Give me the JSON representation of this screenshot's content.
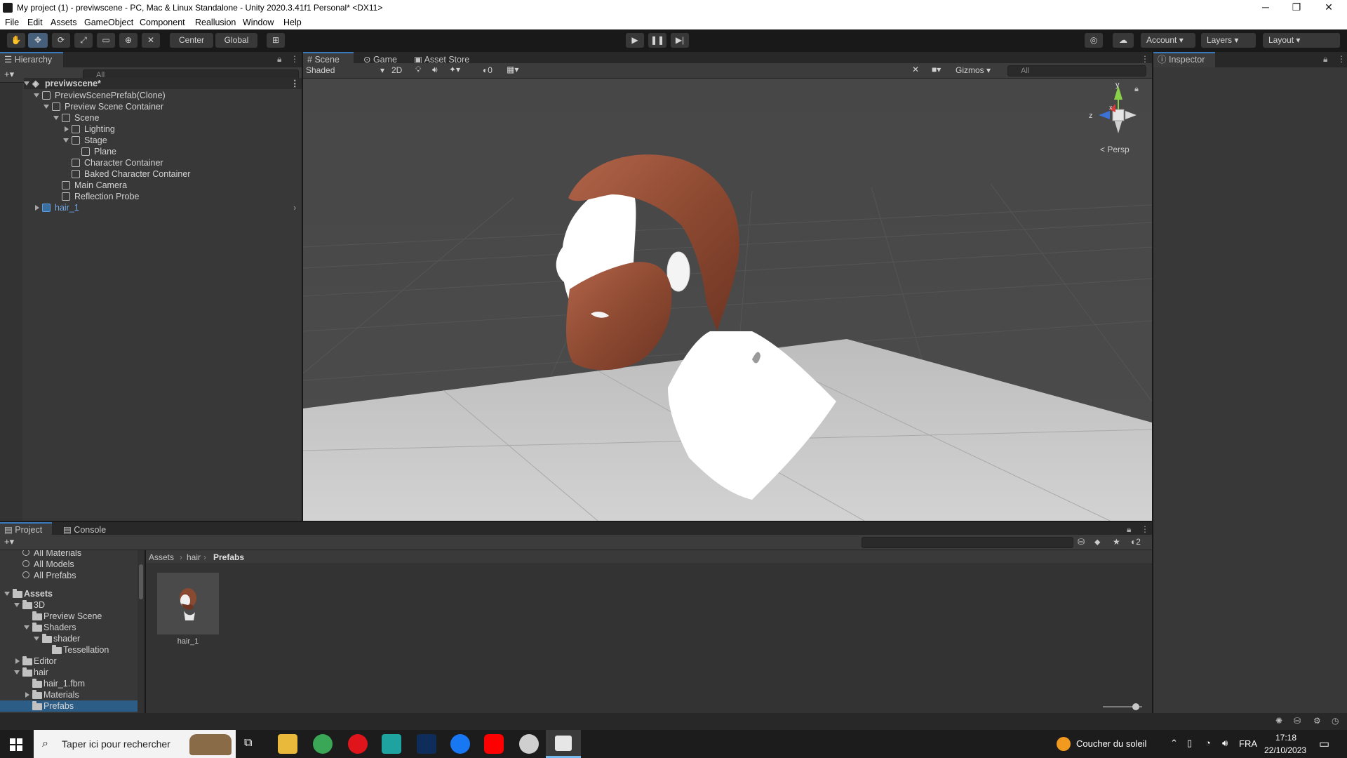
{
  "title_bar": {
    "title": "My project (1) - previwscene - PC, Mac & Linux Standalone - Unity 2020.3.41f1 Personal* <DX11>",
    "minimize": "─",
    "maximize": "❐",
    "close": "✕"
  },
  "menu": [
    "File",
    "Edit",
    "Assets",
    "GameObject",
    "Component",
    "Reallusion",
    "Window",
    "Help"
  ],
  "toolbar": {
    "pivot": "Center",
    "space": "Global",
    "account": "Account",
    "layers": "Layers",
    "layout": "Layout"
  },
  "hierarchy": {
    "tab": "Hierarchy",
    "search_placeholder": "All",
    "add": "+▾",
    "items": [
      {
        "label": "previwscene*"
      },
      {
        "label": "PreviewScenePrefab(Clone)"
      },
      {
        "label": "Preview Scene Container"
      },
      {
        "label": "Scene"
      },
      {
        "label": "Lighting"
      },
      {
        "label": "Stage"
      },
      {
        "label": "Plane"
      },
      {
        "label": "Character Container"
      },
      {
        "label": "Baked Character Container"
      },
      {
        "label": "Main Camera"
      },
      {
        "label": "Reflection Probe"
      },
      {
        "label": "hair_1"
      }
    ]
  },
  "scene": {
    "tabs": [
      "Scene",
      "Game",
      "Asset Store"
    ],
    "shading": "Shaded",
    "toggle_2d": "2D",
    "hidden_count": "0",
    "gizmos": "Gizmos",
    "search_placeholder": "All",
    "gizmo_axes": {
      "y": "y",
      "z": "z",
      "x": "x"
    },
    "projection": "< Persp"
  },
  "inspector": {
    "tab": "Inspector"
  },
  "project": {
    "tabs": [
      "Project",
      "Console"
    ],
    "favorites": [
      "All Materials",
      "All Models",
      "All Prefabs"
    ],
    "tree": [
      {
        "label": "Assets"
      },
      {
        "label": "3D"
      },
      {
        "label": "Preview Scene"
      },
      {
        "label": "Shaders"
      },
      {
        "label": "shader"
      },
      {
        "label": "Tessellation"
      },
      {
        "label": "Editor"
      },
      {
        "label": "hair"
      },
      {
        "label": "hair_1.fbm"
      },
      {
        "label": "Materials"
      },
      {
        "label": "Prefabs"
      }
    ],
    "breadcrumb": [
      "Assets",
      "hair",
      "Prefabs"
    ],
    "asset": "hair_1",
    "hidden_count": "2"
  },
  "taskbar": {
    "search_placeholder": "Taper ici pour rechercher",
    "weather": "Coucher du soleil",
    "language": "FRA",
    "time": "17:18",
    "date": "22/10/2023"
  }
}
